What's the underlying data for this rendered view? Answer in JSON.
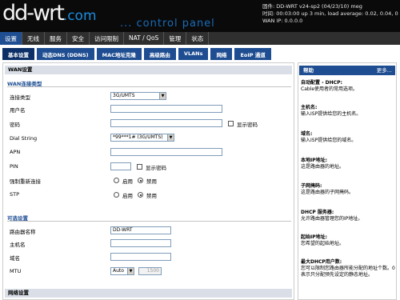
{
  "header": {
    "logo_main": "dd-wrt",
    "logo_suffix": ".com",
    "tagline": "... control panel",
    "firmware": "固件: DD-WRT v24-sp2 (04/23/10) meg",
    "time": "时间: 00:03:00 up 3 min, load average: 0.02, 0.04, 0.0",
    "wan_ip": "WAN IP: 0.0.0.0"
  },
  "main_tabs": [
    "设置",
    "无线",
    "服务",
    "安全",
    "访问限制",
    "NAT / QoS",
    "管理",
    "状态"
  ],
  "sub_tabs": [
    "基本设置",
    "动态DNS (DDNS)",
    "MAC地址克隆",
    "高级路由",
    "VLANs",
    "网络",
    "EoIP 通道"
  ],
  "panel_title": "WAN设置",
  "wan": {
    "section": "WAN连接类型",
    "conn_type_label": "连接类型",
    "conn_type_value": "3G/UMTS",
    "username_label": "用户名",
    "password_label": "密码",
    "show_password": "显示密码",
    "dial_label": "Dial String",
    "dial_value": "*99***1# (3G/UMTS)",
    "apn_label": "APN",
    "pin_label": "PIN",
    "pin_show": "显示密码",
    "force_reconnect_label": "强制重新连接",
    "stp_label": "STP",
    "enable": "启用",
    "disable": "禁用"
  },
  "optional": {
    "section": "可选设置",
    "router_name_label": "路由器名称",
    "router_name_value": "DD-WRT",
    "hostname_label": "主机名",
    "domain_label": "域名",
    "mtu_label": "MTU",
    "mtu_mode": "Auto",
    "mtu_value": "1500"
  },
  "network_section": "网络设置",
  "help": {
    "title": "帮助",
    "more": "更多...",
    "items": [
      {
        "title": "自动配置 - DHCP:",
        "text": "Cable使用者的常用选项。"
      },
      {
        "title": "主机名:",
        "text": "输入ISP提供给您的主机名。"
      },
      {
        "title": "域名:",
        "text": "输入ISP提供给您的域名。"
      },
      {
        "title": "本地IP地址:",
        "text": "这是路由器的地址。"
      },
      {
        "title": "子网掩码:",
        "text": "这是路由器的子网掩码。"
      },
      {
        "title": "DHCP 服务器:",
        "text": "允许路由器管理您的IP地址。"
      },
      {
        "title": "起始IP地址:",
        "text": "您希望的起始地址。"
      },
      {
        "title": "最大DHCP用户数:",
        "text": "您可以限制您路由器所能分配的地址个数。0表示只分配预先设定的静态地址。"
      }
    ]
  }
}
